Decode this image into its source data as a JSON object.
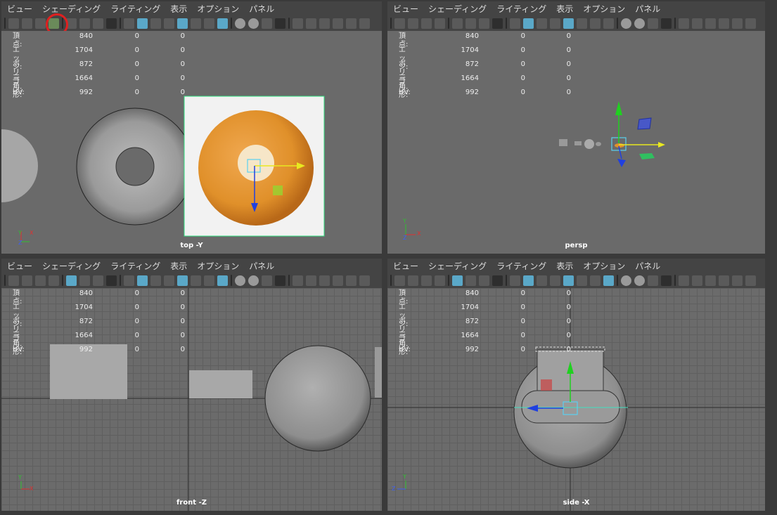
{
  "menu": [
    "ビュー",
    "シェーディング",
    "ライティング",
    "表示",
    "オプション",
    "パネル"
  ],
  "hud": {
    "rows": [
      {
        "label": "頂点:",
        "v1": "840",
        "v2": "0",
        "v3": "0"
      },
      {
        "label": "エッジ:",
        "v1": "1704",
        "v2": "0",
        "v3": "0"
      },
      {
        "label": "ポリゴン:",
        "v1": "872",
        "v2": "0",
        "v3": "0"
      },
      {
        "label": "三角形:",
        "v1": "1664",
        "v2": "0",
        "v3": "0"
      },
      {
        "label": "UV:",
        "v1": "992",
        "v2": "0",
        "v3": "0"
      }
    ]
  },
  "panels": {
    "top": {
      "camera": "top -Y"
    },
    "persp": {
      "camera": "persp"
    },
    "front": {
      "camera": "front -Z"
    },
    "side": {
      "camera": "side -X"
    }
  },
  "axes": {
    "x": "X",
    "y": "Y",
    "z": "Z"
  },
  "icons": [
    "camera-icon",
    "camera-lock-icon",
    "camera-attributes-icon",
    "image-plane-icon",
    "grid-icon",
    "film-gate-icon",
    "resolution-gate-icon",
    "gate-mask-icon",
    "wireframe-icon",
    "smooth-shade-icon",
    "shade-options-icon",
    "wireframe-on-shaded-icon",
    "textured-icon",
    "use-all-lights-icon",
    "shadows-icon",
    "xray-icon",
    "isolate-select-icon"
  ],
  "colors": {
    "highlight": "#e02020",
    "active_icon": "#5aa8c8",
    "move_x": "#e8e820",
    "move_y": "#20d020",
    "move_z": "#2040e0"
  }
}
